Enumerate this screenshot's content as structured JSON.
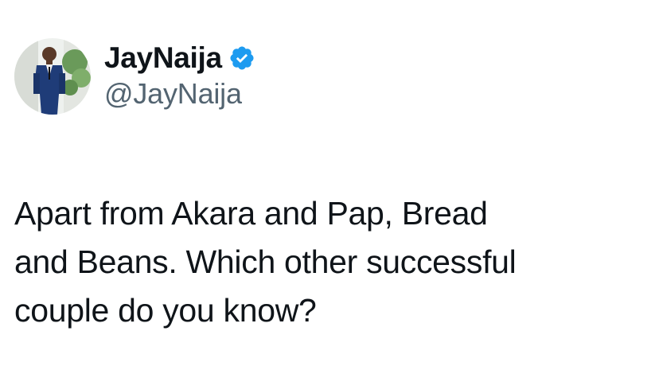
{
  "user": {
    "display_name": "JayNaija",
    "handle": "@JayNaija",
    "verified": true,
    "verified_icon": "verified-badge-icon",
    "verified_color": "#1d9bf0"
  },
  "tweet": {
    "lines": [
      "Apart from Akara and Pap, Bread",
      "and Beans. Which other successful",
      "couple do you know?"
    ]
  },
  "colors": {
    "text_primary": "#0f1419",
    "text_secondary": "#536471",
    "background": "#ffffff"
  }
}
